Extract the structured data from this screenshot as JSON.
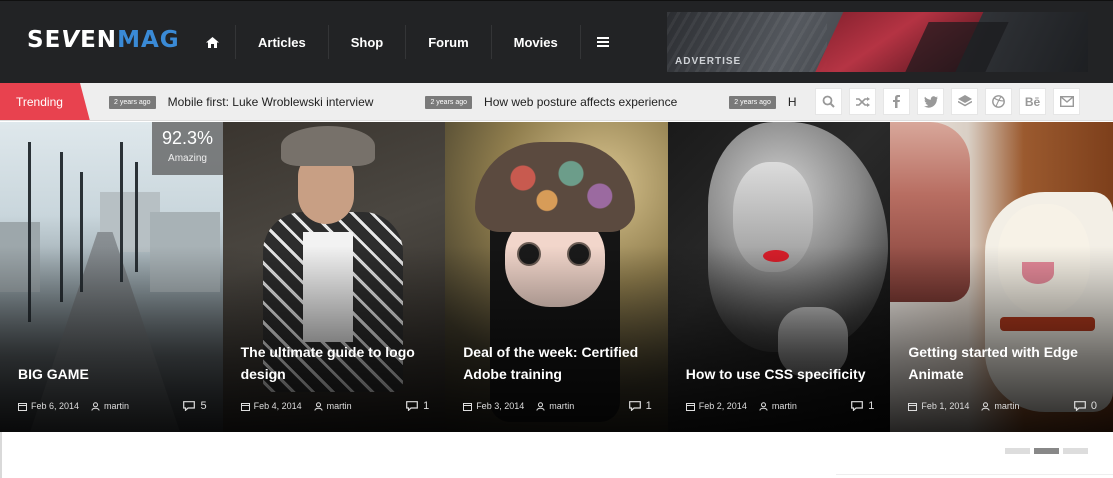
{
  "header": {
    "logo_main": "SE",
    "logo_v": "V",
    "logo_mid": "EN",
    "logo_accent": "MAG",
    "nav": [
      {
        "label": "Articles"
      },
      {
        "label": "Shop"
      },
      {
        "label": "Forum"
      },
      {
        "label": "Movies"
      }
    ],
    "home_icon": "home-icon",
    "menu_icon": "hamburger-icon",
    "ad_label": "ADVERTISE"
  },
  "trending": {
    "label": "Trending",
    "items": [
      {
        "badge": "2 years ago",
        "title": "Mobile first: Luke Wroblewski interview"
      },
      {
        "badge": "2 years ago",
        "title": "How web posture affects experience"
      },
      {
        "badge": "2 years ago",
        "title": "H"
      }
    ],
    "icons": [
      "search-icon",
      "shuffle-icon",
      "facebook-icon",
      "twitter-icon",
      "stack-icon",
      "dribbble-icon",
      "behance-icon",
      "mail-icon"
    ],
    "behance_text": "Bē"
  },
  "cards": [
    {
      "title": "BIG GAME",
      "date": "Feb 6, 2014",
      "author": "martin",
      "comments": "5",
      "score": "92.3%",
      "score_label": "Amazing"
    },
    {
      "title": "The ultimate guide to logo design",
      "date": "Feb 4, 2014",
      "author": "martin",
      "comments": "1"
    },
    {
      "title": "Deal of the week: Certified Adobe training",
      "date": "Feb 3, 2014",
      "author": "martin",
      "comments": "1"
    },
    {
      "title": "How to use CSS specificity",
      "date": "Feb 2, 2014",
      "author": "martin",
      "comments": "1"
    },
    {
      "title": "Getting started with Edge Animate",
      "date": "Feb 1, 2014",
      "author": "martin",
      "comments": "0"
    }
  ],
  "pager": {
    "count": 3,
    "active": 1
  },
  "colors": {
    "header_bg": "#222325",
    "accent_blue": "#3a8ad6",
    "trending_red": "#e8424f"
  }
}
